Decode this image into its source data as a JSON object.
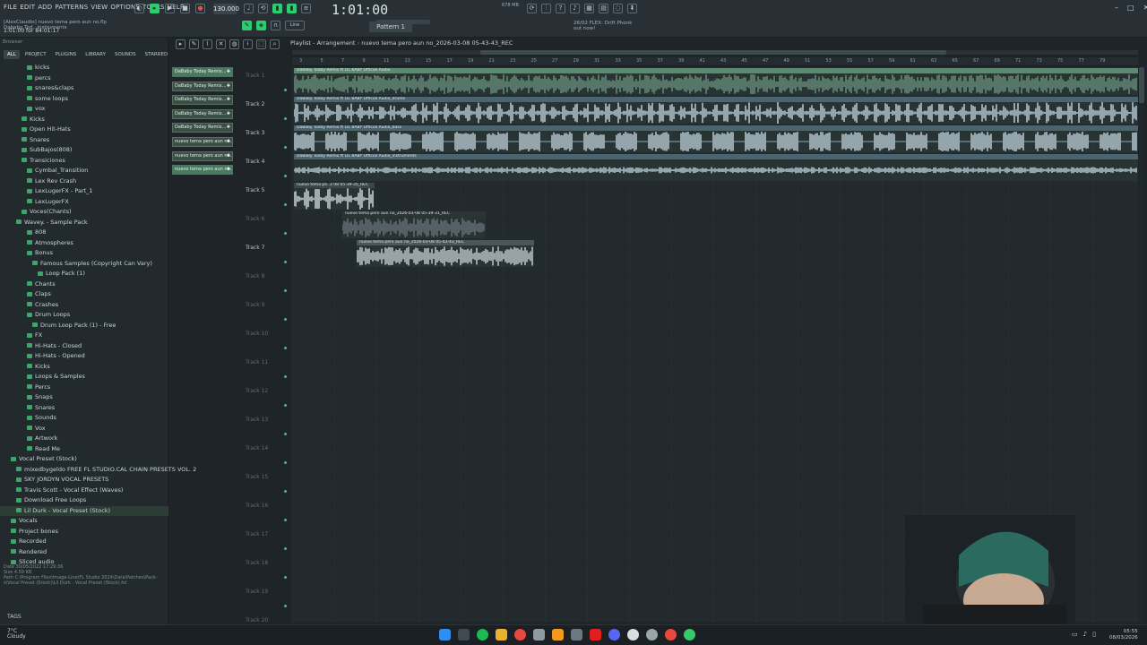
{
  "menu": [
    "FILE",
    "EDIT",
    "ADD",
    "PATTERNS",
    "VIEW",
    "OPTIONS",
    "TOOLS",
    "HELP"
  ],
  "project": {
    "user": "[AlexClaudio] nuevo tema pero aun no.flp",
    "hint_line": "Dababy Tod...instruments",
    "time_readout": "1:01:00 for 84:01:17"
  },
  "transport": {
    "tempo": "130.000",
    "clock": "1:01:00",
    "pattern": "Pattern 1",
    "cpu": "678 MB",
    "snap": "Line"
  },
  "hint": {
    "line1": "26/02 FLEX: Drift Phonk",
    "line2": "out now!"
  },
  "browser": {
    "title": "Browser",
    "tabs": [
      "ALL",
      "PROJECT",
      "PLUGINS",
      "LIBRARY",
      "SOUNDS",
      "STARRED"
    ],
    "items": [
      {
        "label": "kicks",
        "indent": 4
      },
      {
        "label": "percs",
        "indent": 4
      },
      {
        "label": "snares&claps",
        "indent": 4
      },
      {
        "label": "some loops",
        "indent": 4
      },
      {
        "label": "vox",
        "indent": 4
      },
      {
        "label": "Kicks",
        "indent": 3
      },
      {
        "label": "Open Hit-Hats",
        "indent": 3
      },
      {
        "label": "Snares",
        "indent": 3
      },
      {
        "label": "SubBajos(808)",
        "indent": 3
      },
      {
        "label": "Transiciones",
        "indent": 3
      },
      {
        "label": "Cymbal_Transition",
        "indent": 4
      },
      {
        "label": "Lex Rev Crash",
        "indent": 4
      },
      {
        "label": "LexLugerFX - Part_1",
        "indent": 4
      },
      {
        "label": "LexLugerFX",
        "indent": 4
      },
      {
        "label": "Voces(Chants)",
        "indent": 3
      },
      {
        "label": "Wavey. - Sample Pack",
        "indent": 2
      },
      {
        "label": "808",
        "indent": 4
      },
      {
        "label": "Atmospheres",
        "indent": 4
      },
      {
        "label": "Bonus",
        "indent": 4
      },
      {
        "label": "Famous Samples (Copyright Can Vary)",
        "indent": 5
      },
      {
        "label": "Loop Pack (1)",
        "indent": 6
      },
      {
        "label": "Chants",
        "indent": 4
      },
      {
        "label": "Claps",
        "indent": 4
      },
      {
        "label": "Crashes",
        "indent": 4
      },
      {
        "label": "Drum Loops",
        "indent": 4
      },
      {
        "label": "Drum Loop Pack (1) - Free",
        "indent": 5
      },
      {
        "label": "FX",
        "indent": 4
      },
      {
        "label": "Hi-Hats - Closed",
        "indent": 4
      },
      {
        "label": "Hi-Hats - Opened",
        "indent": 4
      },
      {
        "label": "Kicks",
        "indent": 4
      },
      {
        "label": "Loops & Samples",
        "indent": 4
      },
      {
        "label": "Percs",
        "indent": 4
      },
      {
        "label": "Snaps",
        "indent": 4
      },
      {
        "label": "Snares",
        "indent": 4
      },
      {
        "label": "Sounds",
        "indent": 4
      },
      {
        "label": "Vox",
        "indent": 4
      },
      {
        "label": "Artwork",
        "indent": 4
      },
      {
        "label": "Read Me",
        "indent": 4
      },
      {
        "label": "Vocal Preset (Stock)",
        "indent": 1
      },
      {
        "label": "mixedbygeldo FREE FL STUDIO.CAL CHAIN PRESETS VOL. 2",
        "indent": 2
      },
      {
        "label": "SKY JORDYN VOCAL PRESETS",
        "indent": 2
      },
      {
        "label": "Travis Scott - Vocal Effect (Waves)",
        "indent": 2
      },
      {
        "label": "Download Free Loops",
        "indent": 2
      },
      {
        "label": "Lil Durk - Vocal Preset (Stock)",
        "indent": 2
      },
      {
        "label": "Vocals",
        "indent": 1
      },
      {
        "label": "Project bones",
        "indent": 1
      },
      {
        "label": "Recorded",
        "indent": 1
      },
      {
        "label": "Rendered",
        "indent": 1
      },
      {
        "label": "Sliced audio",
        "indent": 1
      }
    ],
    "selected_index": 43,
    "file_info": {
      "date": "Date  30/05/2022 17:29:36",
      "size": "Size  4.59 KB",
      "path": "Path  C:\\Program Files\\Image-Line\\FL Studio 2024\\Data\\Patches\\Pack-s\\Vocal Preset (Stock)\\Lil Durk - Vocal Preset (Stock).fst"
    },
    "tags": "TAGS"
  },
  "clips": [
    "DaBaby Today Remix...",
    "DaBaby Today Remix...",
    "DaBaby Today Remix...",
    "DaBaby Today Remix...",
    "DaBaby Today Remix...",
    "nuevo tema pero aun no...",
    "nuevo tema pero aun no...",
    "nuevo tema pero aun no..."
  ],
  "playlist": {
    "title": "Playlist - Arrangement",
    "arrangement": "nuevo tema pero aun no_2026-03-08 05-43-43_REC",
    "ruler": [
      "3",
      "5",
      "7",
      "9",
      "11",
      "13",
      "15",
      "17",
      "19",
      "21",
      "23",
      "25",
      "27",
      "29",
      "31",
      "33",
      "35",
      "37",
      "39",
      "41",
      "43",
      "45",
      "47",
      "49",
      "51",
      "53",
      "55",
      "57",
      "59",
      "61",
      "63",
      "65",
      "67",
      "69",
      "71",
      "73",
      "75",
      "77",
      "79"
    ],
    "tracks": [
      "Track 1",
      "Track 2",
      "Track 3",
      "Track 4",
      "Track 5",
      "Track 6",
      "Track 7",
      "Track 8",
      "Track 9",
      "Track 10",
      "Track 11",
      "Track 12",
      "Track 13",
      "Track 14",
      "Track 15",
      "Track 16",
      "Track 17",
      "Track 18",
      "Track 19",
      "Track 20"
    ],
    "lane_clips": [
      "DaBaby Today Remix ft LIL BABY Official Audio",
      "DaBaby Today Remix ft LIL BABY Official Audio_drums",
      "DaBaby Today Remix ft LIL BABY Official Audio_bass",
      "DaBaby Today Remix ft LIL BABY Official Audio_instruments",
      "nuevo tema pe..3 08 05-39-35_REC",
      "nuevo tema pero aun no_2026-03-08 05-39-31_REC",
      "nuevo tema pero aun no_2026-03-08 05-43-43_REC"
    ]
  },
  "taskbar": {
    "weather_temp": "7°C",
    "weather_desc": "Cloudy",
    "time": "05:55",
    "date": "08/03/2026"
  }
}
